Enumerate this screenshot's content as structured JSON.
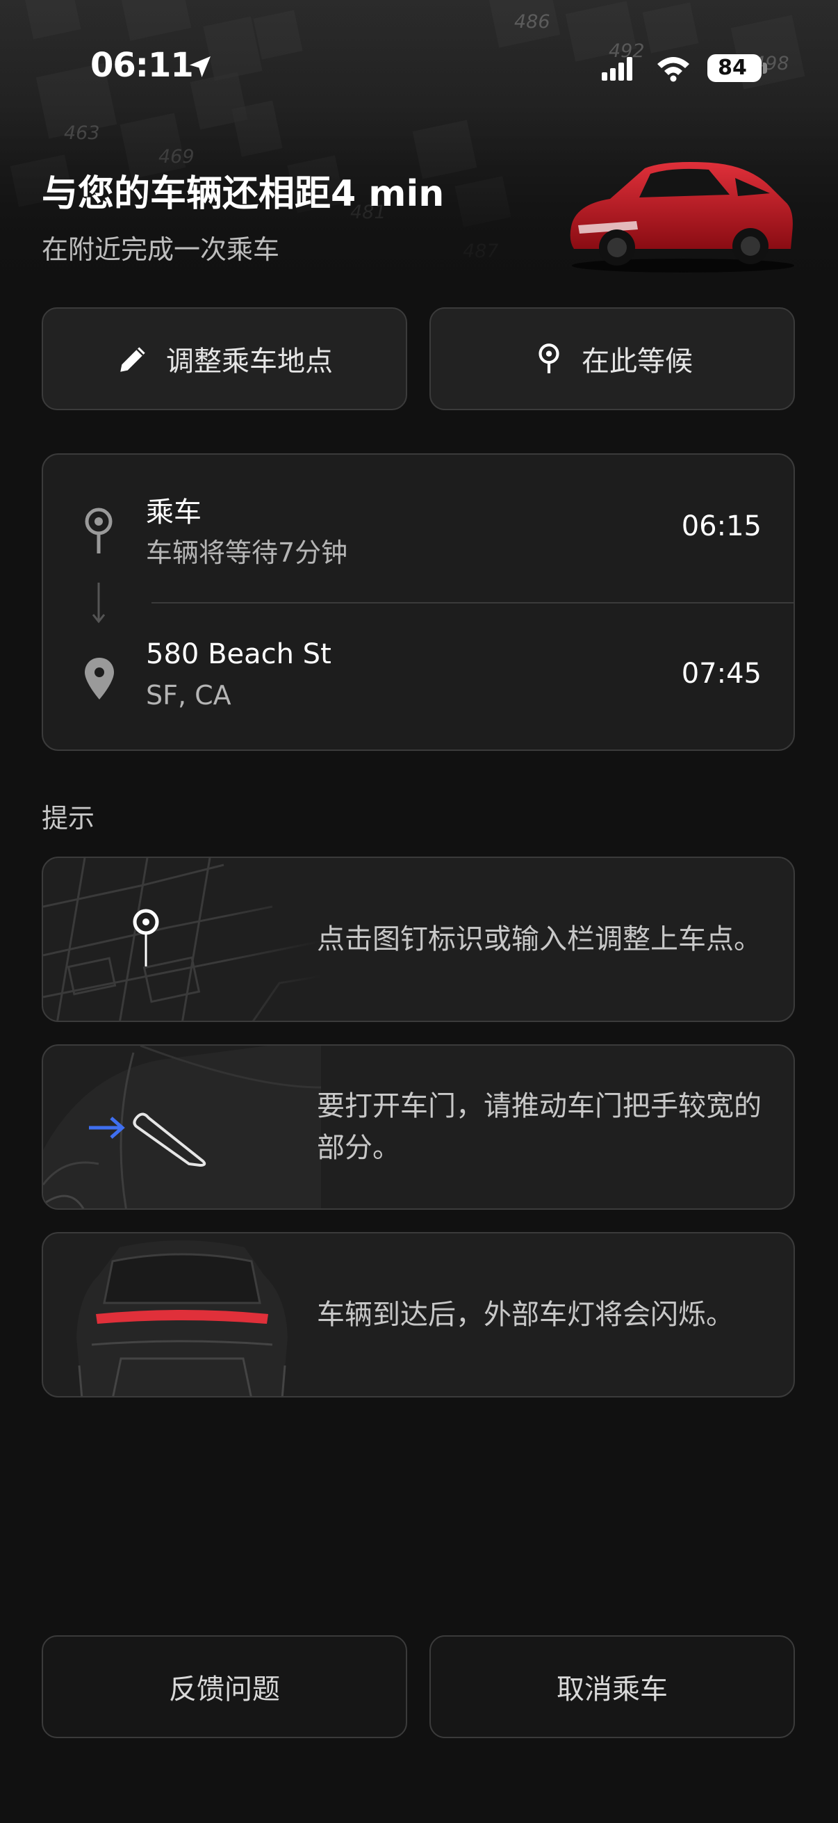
{
  "status_bar": {
    "time": "06:11",
    "battery": "84",
    "icons": [
      "location-arrow-icon",
      "cellular-signal-icon",
      "wifi-icon",
      "battery-icon"
    ]
  },
  "header": {
    "title": "与您的车辆还相距4 min",
    "subtitle": "在附近完成一次乘车",
    "map_block_numbers": [
      "486",
      "492",
      "498",
      "463",
      "469",
      "481",
      "487"
    ]
  },
  "actions": {
    "adjust_pickup_label": "调整乘车地点",
    "wait_here_label": "在此等候"
  },
  "trip": {
    "pickup": {
      "title": "乘车",
      "subtitle": "车辆将等待7分钟",
      "time": "06:15"
    },
    "dropoff": {
      "title": "580 Beach St",
      "subtitle": "SF, CA",
      "time": "07:45"
    }
  },
  "tips": {
    "section_label": "提示",
    "items": [
      {
        "text": "点击图钉标识或输入栏调整上车点。",
        "icon": "map-pin-icon"
      },
      {
        "text": "要打开车门，请推动车门把手较宽的部分。",
        "icon": "door-handle-icon"
      },
      {
        "text": "车辆到达后，外部车灯将会闪烁。",
        "icon": "car-rear-lights-icon"
      }
    ]
  },
  "footer": {
    "feedback_label": "反馈问题",
    "cancel_label": "取消乘车"
  },
  "colors": {
    "background": "#111111",
    "card": "#1d1d1d",
    "border": "#3b3b3b",
    "accent_blue": "#3f6ff0",
    "car_red": "#c4121c",
    "tail_light": "#e0303a"
  }
}
